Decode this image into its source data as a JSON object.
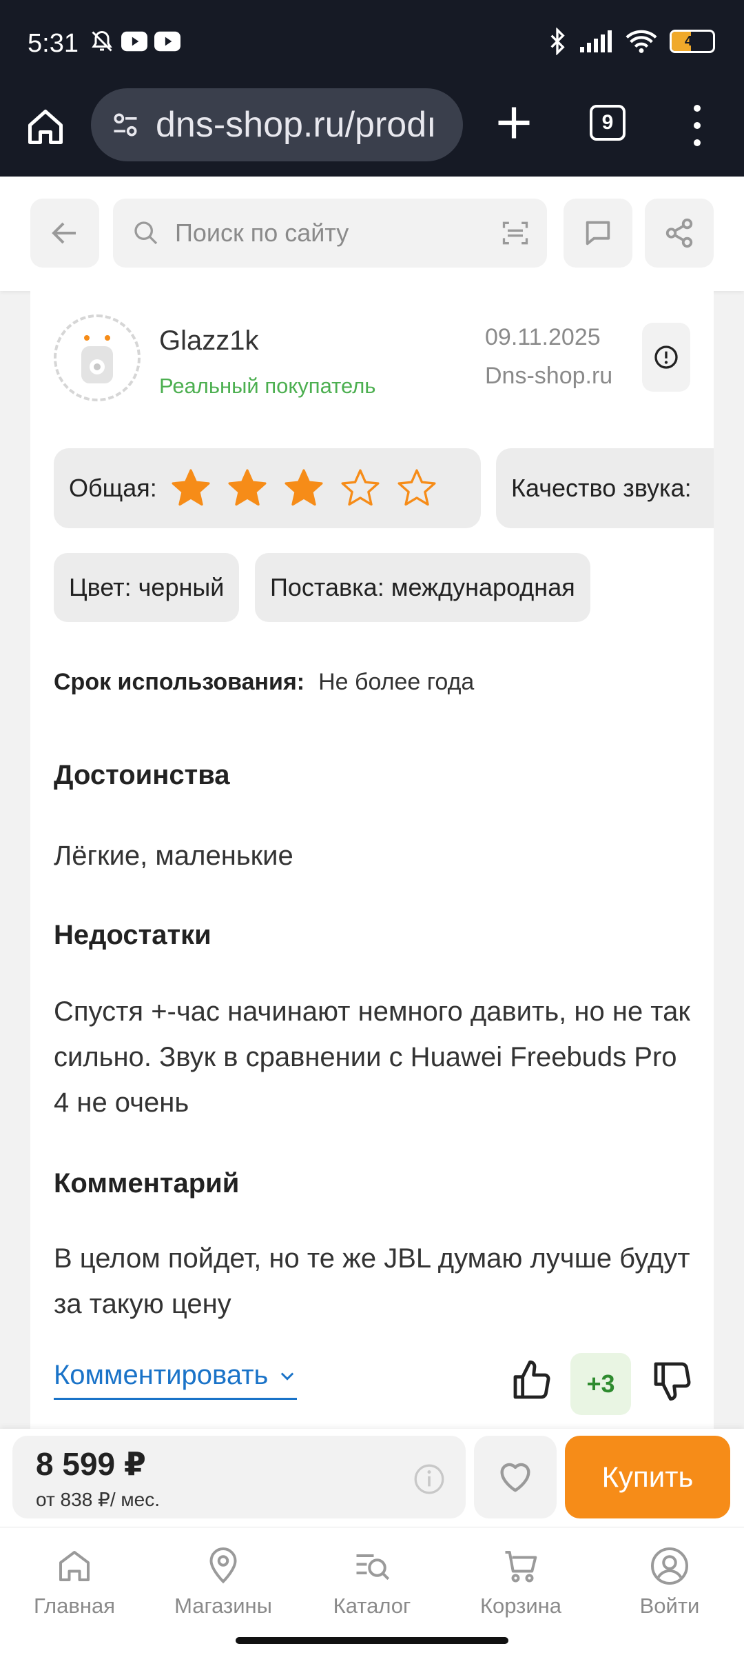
{
  "status_bar": {
    "time": "5:31",
    "battery": "47",
    "battery_level": 0.47
  },
  "browser": {
    "url": "dns-shop.ru/prodı",
    "tab_count": "9"
  },
  "header": {
    "search_placeholder": "Поиск по сайту"
  },
  "review": {
    "username": "Glazz1k",
    "buyer_badge": "Реальный покупатель",
    "date": "09.11.2025",
    "source": "Dns-shop.ru",
    "overall_label": "Общая:",
    "overall_rating": 3,
    "max_rating": 5,
    "sound_label": "Качество звука:",
    "chips": [
      "Цвет: черный",
      "Поставка: международная"
    ],
    "usage_label": "Срок использования:",
    "usage_value": "Не более года",
    "pros_title": "Достоинства",
    "pros_text": "Лёгкие, маленькие",
    "cons_title": "Недостатки",
    "cons_text": "Спустя +-час начинают немного давить, но не так сильно. Звук в сравнении с Huawei Freebuds Pro 4 не очень",
    "comment_title": "Комментарий",
    "comment_text": "В целом пойдет, но те же JBL думаю лучше будут за такую цену",
    "comment_link": "Комментировать",
    "votes": "+3"
  },
  "buy": {
    "price": "8 599 ₽",
    "monthly": "от 838 ₽/ мес.",
    "buy_label": "Купить"
  },
  "nav": [
    {
      "label": "Главная",
      "icon": "home-icon"
    },
    {
      "label": "Магазины",
      "icon": "location-pin-icon"
    },
    {
      "label": "Каталог",
      "icon": "catalog-search-icon"
    },
    {
      "label": "Корзина",
      "icon": "cart-icon"
    },
    {
      "label": "Войти",
      "icon": "user-icon"
    }
  ],
  "colors": {
    "accent": "#f68c18",
    "buyer_green": "#4caf50",
    "link_blue": "#1a73c8",
    "chrome_bg": "#161a25"
  }
}
